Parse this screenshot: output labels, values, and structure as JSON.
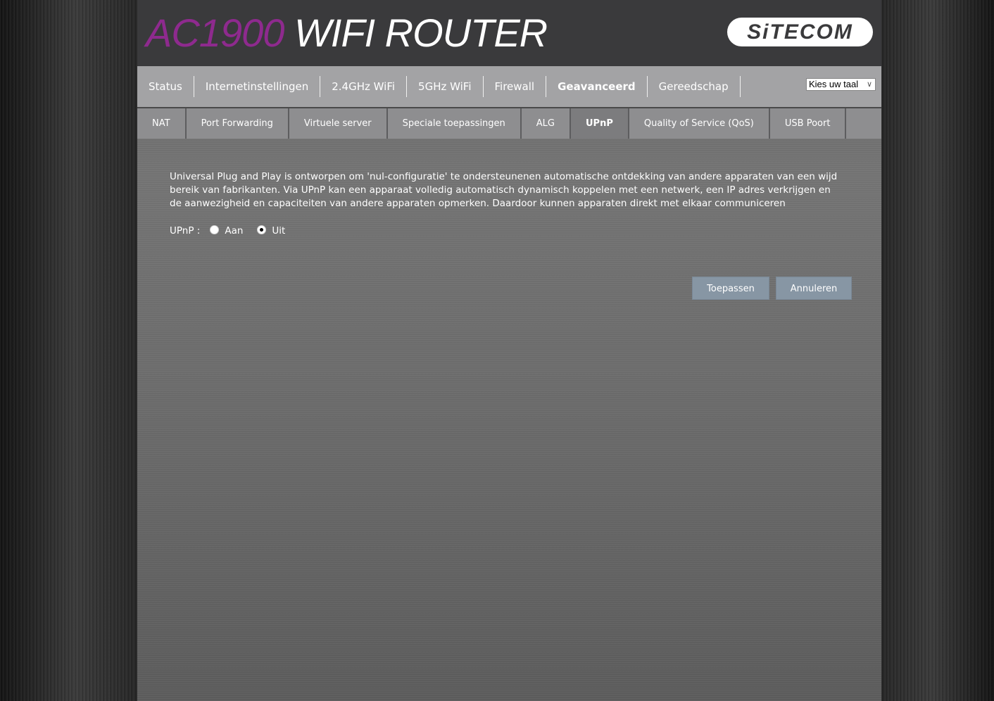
{
  "header": {
    "product_model": "AC1900",
    "product_name": "WIFI ROUTER",
    "brand": "SiTECOM",
    "colors": {
      "model": "#8e2a8e",
      "header_bg": "#3a3a3c"
    }
  },
  "mainnav": {
    "items": [
      {
        "label": "Status",
        "active": false
      },
      {
        "label": "Internetinstellingen",
        "active": false
      },
      {
        "label": "2.4GHz WiFi",
        "active": false
      },
      {
        "label": "5GHz WiFi",
        "active": false
      },
      {
        "label": "Firewall",
        "active": false
      },
      {
        "label": "Geavanceerd",
        "active": true
      },
      {
        "label": "Gereedschap",
        "active": false
      }
    ],
    "language_select": {
      "selected": "Kies uw taal",
      "icon": "chevron-down-icon"
    }
  },
  "subnav": {
    "tabs": [
      {
        "label": "NAT",
        "active": false
      },
      {
        "label": "Port Forwarding",
        "active": false
      },
      {
        "label": "Virtuele server",
        "active": false
      },
      {
        "label": "Speciale toepassingen",
        "active": false
      },
      {
        "label": "ALG",
        "active": false
      },
      {
        "label": "UPnP",
        "active": true
      },
      {
        "label": "Quality of Service (QoS)",
        "active": false
      },
      {
        "label": "USB Poort",
        "active": false
      }
    ]
  },
  "content": {
    "description": "Universal Plug and Play is ontworpen om 'nul-configuratie' te ondersteunenen automatische ontdekking van andere apparaten van een wijd bereik van fabrikanten. Via UPnP kan een apparaat volledig automatisch dynamisch koppelen met een netwerk, een IP adres verkrijgen en de aanwezigheid en capaciteiten van andere apparaten opmerken. Daardoor kunnen apparaten direkt met elkaar communiceren",
    "upnp": {
      "label": "UPnP :",
      "options": [
        {
          "label": "Aan",
          "checked": false
        },
        {
          "label": "Uit",
          "checked": true
        }
      ]
    }
  },
  "buttons": {
    "apply": "Toepassen",
    "cancel": "Annuleren",
    "color": "#8796a4"
  }
}
